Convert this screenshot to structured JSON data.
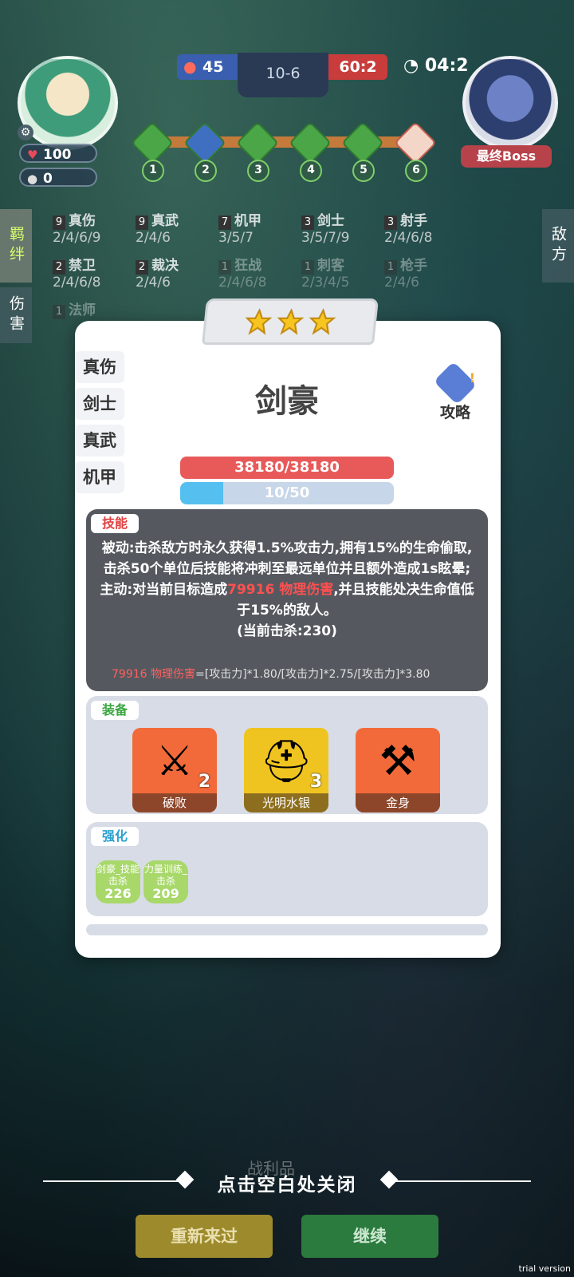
{
  "hud": {
    "hp": "100",
    "coins": "0",
    "score_left": "45",
    "round": "10-6",
    "score_right": "60:2",
    "timer": "04:2",
    "boss_label": "最终Boss",
    "stages": [
      "1",
      "2",
      "3",
      "4",
      "5",
      "6"
    ]
  },
  "side_tabs": {
    "left_top": "羁绊",
    "left_bottom": "伤害",
    "right": "敌方"
  },
  "synergies": [
    {
      "count": "9",
      "name": "真伤",
      "levels": "2/4/6/9",
      "faded": false
    },
    {
      "count": "9",
      "name": "真武",
      "levels": "2/4/6",
      "faded": false
    },
    {
      "count": "7",
      "name": "机甲",
      "levels": "3/5/7",
      "faded": false
    },
    {
      "count": "3",
      "name": "剑士",
      "levels": "3/5/7/9",
      "faded": false
    },
    {
      "count": "3",
      "name": "射手",
      "levels": "2/4/6/8",
      "faded": false
    },
    {
      "count": "2",
      "name": "禁卫",
      "levels": "2/4/6/8",
      "faded": false
    },
    {
      "count": "2",
      "name": "裁决",
      "levels": "2/4/6",
      "faded": false
    },
    {
      "count": "1",
      "name": "狂战",
      "levels": "2/4/6/8",
      "faded": true
    },
    {
      "count": "1",
      "name": "刺客",
      "levels": "2/3/4/5",
      "faded": true
    },
    {
      "count": "1",
      "name": "枪手",
      "levels": "2/4/6",
      "faded": true
    },
    {
      "count": "1",
      "name": "法师",
      "levels": "",
      "faded": true
    }
  ],
  "modal": {
    "stars": 3,
    "traits": [
      "真伤",
      "剑士",
      "真武",
      "机甲"
    ],
    "hero_name": "剑豪",
    "guide_label": "攻略",
    "hp_text": "38180/38180",
    "mana_text": "10/50",
    "mana_value": 10,
    "mana_max": 50,
    "skill": {
      "tag": "技能",
      "line1": "被动:击杀敌方时永久获得1.5%攻击力,拥有15%的生命偷取,击杀50个单位后技能将冲刺至最远单位并且额外造成1s眩晕;",
      "line2_pre": "主动:对当前目标造成",
      "line2_hl": "79916 物理伤害",
      "line2_post": ",并且技能处决生命值低于15%的敌人。",
      "line3": "(当前击杀:230)",
      "formula_red": "79916 物理伤害",
      "formula_rest": "=[攻击力]*1.80/[攻击力]*2.75/[攻击力]*3.80"
    },
    "equip": {
      "tag": "装备",
      "items": [
        {
          "name": "破败",
          "level": "2",
          "icon": "crossed-swords-icon",
          "color": "#f26a3a"
        },
        {
          "name": "光明水银",
          "level": "3",
          "icon": "helmet-icon",
          "color": "#f0c420"
        },
        {
          "name": "金身",
          "level": "",
          "icon": "winged-hammer-icon",
          "color": "#f26a3a"
        }
      ]
    },
    "enhance": {
      "tag": "强化",
      "chips": [
        {
          "label": "剑豪_技能击杀",
          "value": "226"
        },
        {
          "label": "力量训练_击杀",
          "value": "209"
        }
      ]
    }
  },
  "footer": {
    "close_hint": "点击空白处关闭",
    "spoils": "战利品",
    "retry": "重新来过",
    "continue": "继续",
    "trial": "trial version"
  }
}
